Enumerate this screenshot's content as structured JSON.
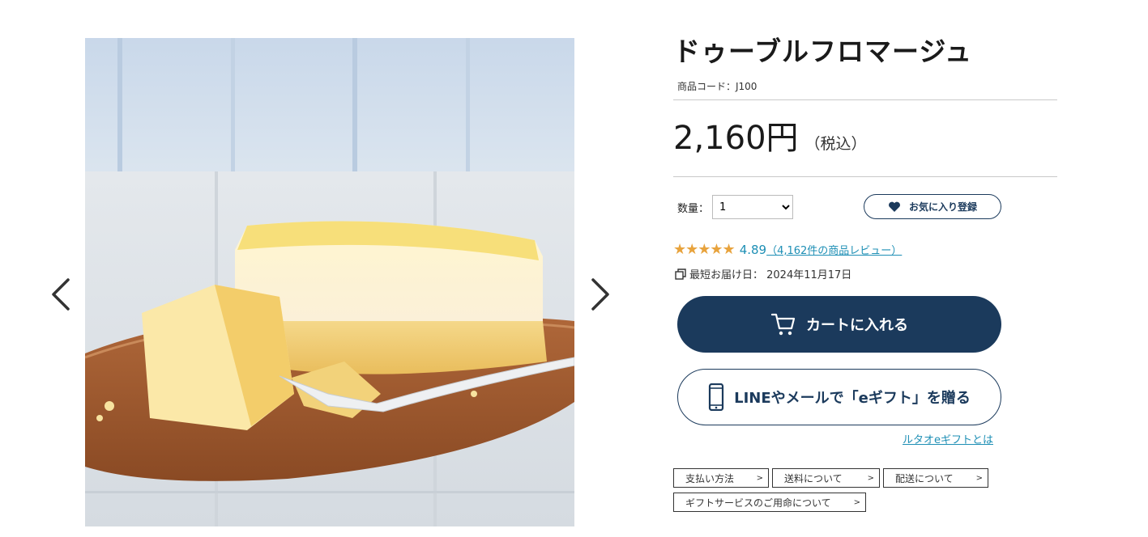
{
  "product": {
    "title": "ドゥーブルフロマージュ",
    "code": "商品コード：J100",
    "price": "2,160円",
    "tax_label": "（税込）"
  },
  "quantity": {
    "label": "数量：",
    "selected": "1",
    "options": [
      "1"
    ]
  },
  "favorite_button": {
    "label": "お気に入り登録",
    "icon": "heart-icon"
  },
  "rating": {
    "stars": "★★★★★",
    "score": "4.89",
    "reviews_link": "（4,162件の商品レビュー）"
  },
  "delivery": {
    "text": "最短お届け日： 2024年11月17日"
  },
  "cart_button": {
    "label": "カートに入れる",
    "icon": "cart-icon"
  },
  "gift_button": {
    "label": "LINEやメールで「eギフト」を贈る",
    "icon": "smartphone-icon"
  },
  "egift_link": "ルタオeギフトとは",
  "info_links": [
    {
      "label": "支払い方法"
    },
    {
      "label": "送料について"
    },
    {
      "label": "配送について"
    },
    {
      "label": "ギフトサービスのご用命について"
    }
  ],
  "info_link_chevron": ">",
  "colors": {
    "navy": "#1b3a5c",
    "link": "#1e8fb5",
    "star": "#e8a33d"
  }
}
